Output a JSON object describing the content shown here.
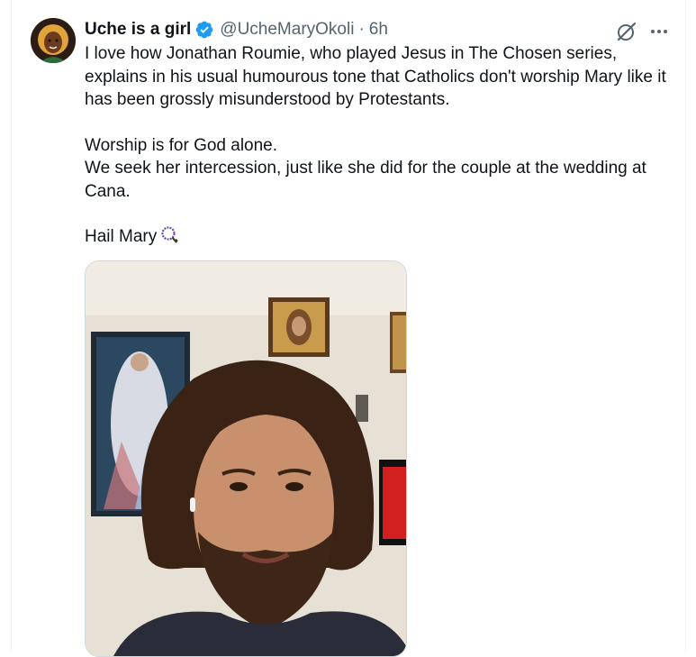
{
  "tweet": {
    "display_name": "Uche is a girl",
    "handle": "@UcheMaryOkoli",
    "separator": "·",
    "time": "6h",
    "paragraphs": [
      "I love how Jonathan Roumie, who played Jesus in The Chosen series, explains in his usual humourous tone that Catholics don't worship Mary like it has been grossly misunderstood by Protestants.",
      "Worship is for God alone.",
      "We seek her intercession, just like she did for the couple at the wedding at Cana.",
      "Hail Mary"
    ]
  },
  "icons": {
    "verified": "verified-badge-icon",
    "grok": "grok-icon",
    "more": "more-options-icon",
    "rosary": "rosary-emoji-icon"
  },
  "colors": {
    "verified_blue": "#1d9bf0",
    "secondary_text": "#536471",
    "primary_text": "#0f1419",
    "border": "#cfd9de"
  }
}
